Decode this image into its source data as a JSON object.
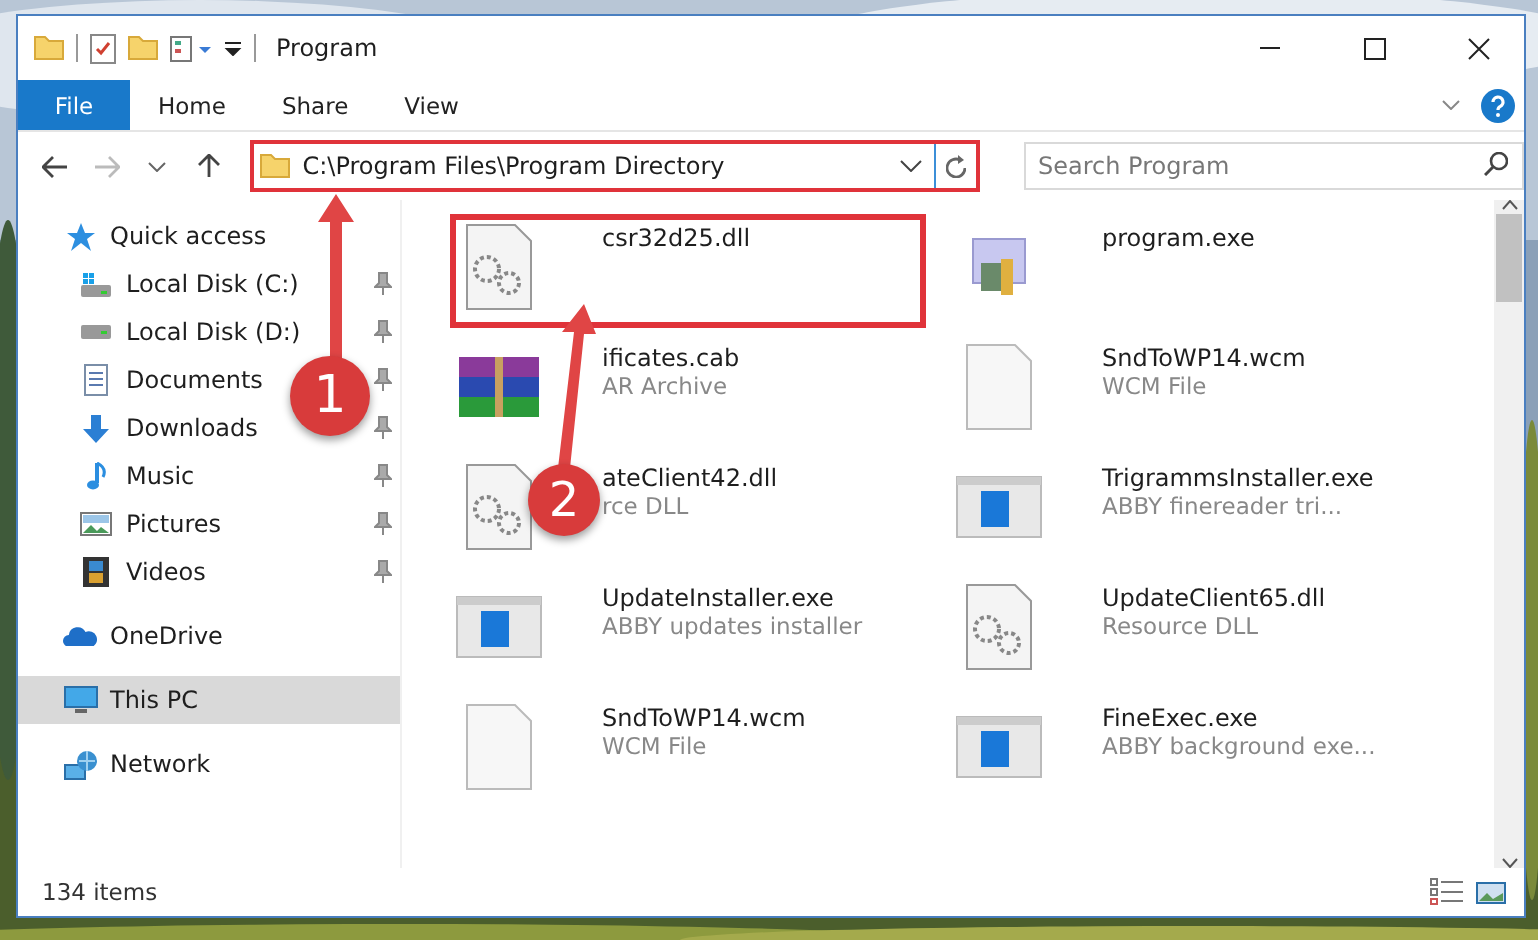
{
  "window": {
    "title": "Program"
  },
  "ribbon_tabs": [
    {
      "label": "File",
      "kind": "file",
      "selected": false
    },
    {
      "label": "Home",
      "kind": "plain",
      "selected": false
    },
    {
      "label": "Share",
      "kind": "plain",
      "selected": false
    },
    {
      "label": "View",
      "kind": "plain",
      "selected": false
    }
  ],
  "address": {
    "path": "C:\\Program Files\\Program Directory"
  },
  "search": {
    "placeholder": "Search Program"
  },
  "nav": [
    {
      "label": "Quick access",
      "kind": "star",
      "selected": false,
      "children": [
        {
          "label": "Local Disk (C:)",
          "kind": "system",
          "selected": false,
          "pinned": true
        },
        {
          "label": "Local Disk (D:)",
          "kind": "disk",
          "selected": false,
          "pinned": true
        },
        {
          "label": "Documents",
          "kind": "documents",
          "selected": false,
          "pinned": true
        },
        {
          "label": "Downloads",
          "kind": "downloads",
          "selected": false,
          "pinned": true
        },
        {
          "label": "Music",
          "kind": "music",
          "selected": false,
          "pinned": true
        },
        {
          "label": "Pictures",
          "kind": "pictures",
          "selected": false,
          "pinned": true
        },
        {
          "label": "Videos",
          "kind": "videos",
          "selected": false,
          "pinned": true
        }
      ]
    },
    {
      "label": "OneDrive",
      "kind": "cloud",
      "selected": false
    },
    {
      "label": "This PC",
      "kind": "computer",
      "selected": true
    },
    {
      "label": "Network",
      "kind": "network",
      "selected": false
    }
  ],
  "files": [
    {
      "name": "csr32d25.dll",
      "kind": "dll"
    },
    {
      "name": "program.exe",
      "kind": "exe"
    },
    {
      "name": "ificates.cab",
      "type": "AR Archive",
      "kind": "archive"
    },
    {
      "name": "SndToWP14.wcm",
      "type": "WCM File",
      "kind": "blank"
    },
    {
      "name": "ateClient42.dll",
      "type": "rce DLL",
      "kind": "dll"
    },
    {
      "name": "TrigrammsInstaller.exe",
      "type": "ABBY finereader tri...",
      "kind": "installer"
    },
    {
      "name": "UpdateInstaller.exe",
      "type": "ABBY updates installer",
      "kind": "installer"
    },
    {
      "name": "UpdateClient65.dll",
      "type": "Resource DLL",
      "kind": "dll"
    },
    {
      "name": "SndToWP14.wcm",
      "type": "WCM File",
      "kind": "blank"
    },
    {
      "name": "FineExec.exe",
      "type": "ABBY background exe...",
      "kind": "installer"
    }
  ],
  "callouts": [
    {
      "label": "1"
    },
    {
      "label": "2"
    }
  ],
  "status_bar": {
    "count": "134 items"
  }
}
